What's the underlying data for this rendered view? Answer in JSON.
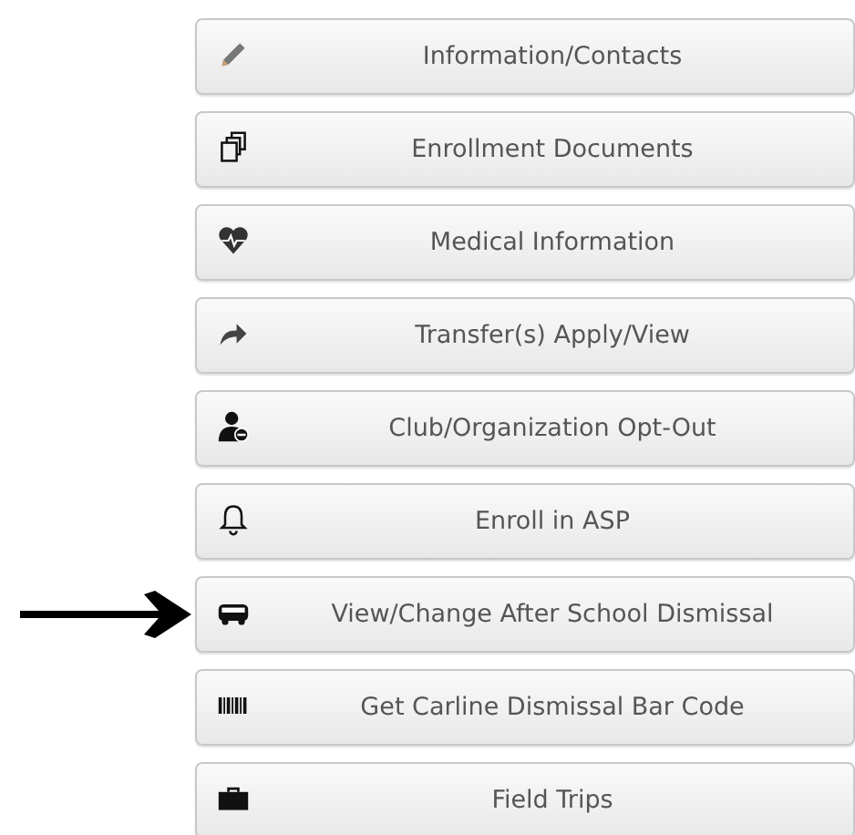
{
  "buttons": [
    {
      "label": "Information/Contacts",
      "kind": "pencil",
      "pointed": false
    },
    {
      "label": "Enrollment Documents",
      "kind": "documents",
      "pointed": false
    },
    {
      "label": "Medical Information",
      "kind": "heart",
      "pointed": false
    },
    {
      "label": "Transfer(s) Apply/View",
      "kind": "share",
      "pointed": false
    },
    {
      "label": "Club/Organization Opt-Out",
      "kind": "user-minus",
      "pointed": false
    },
    {
      "label": "Enroll in ASP",
      "kind": "bell",
      "pointed": false
    },
    {
      "label": "View/Change After School Dismissal",
      "kind": "bus",
      "pointed": true
    },
    {
      "label": "Get Carline Dismissal Bar Code",
      "kind": "barcode",
      "pointed": false
    },
    {
      "label": "Field Trips",
      "kind": "briefcase",
      "pointed": false
    }
  ]
}
